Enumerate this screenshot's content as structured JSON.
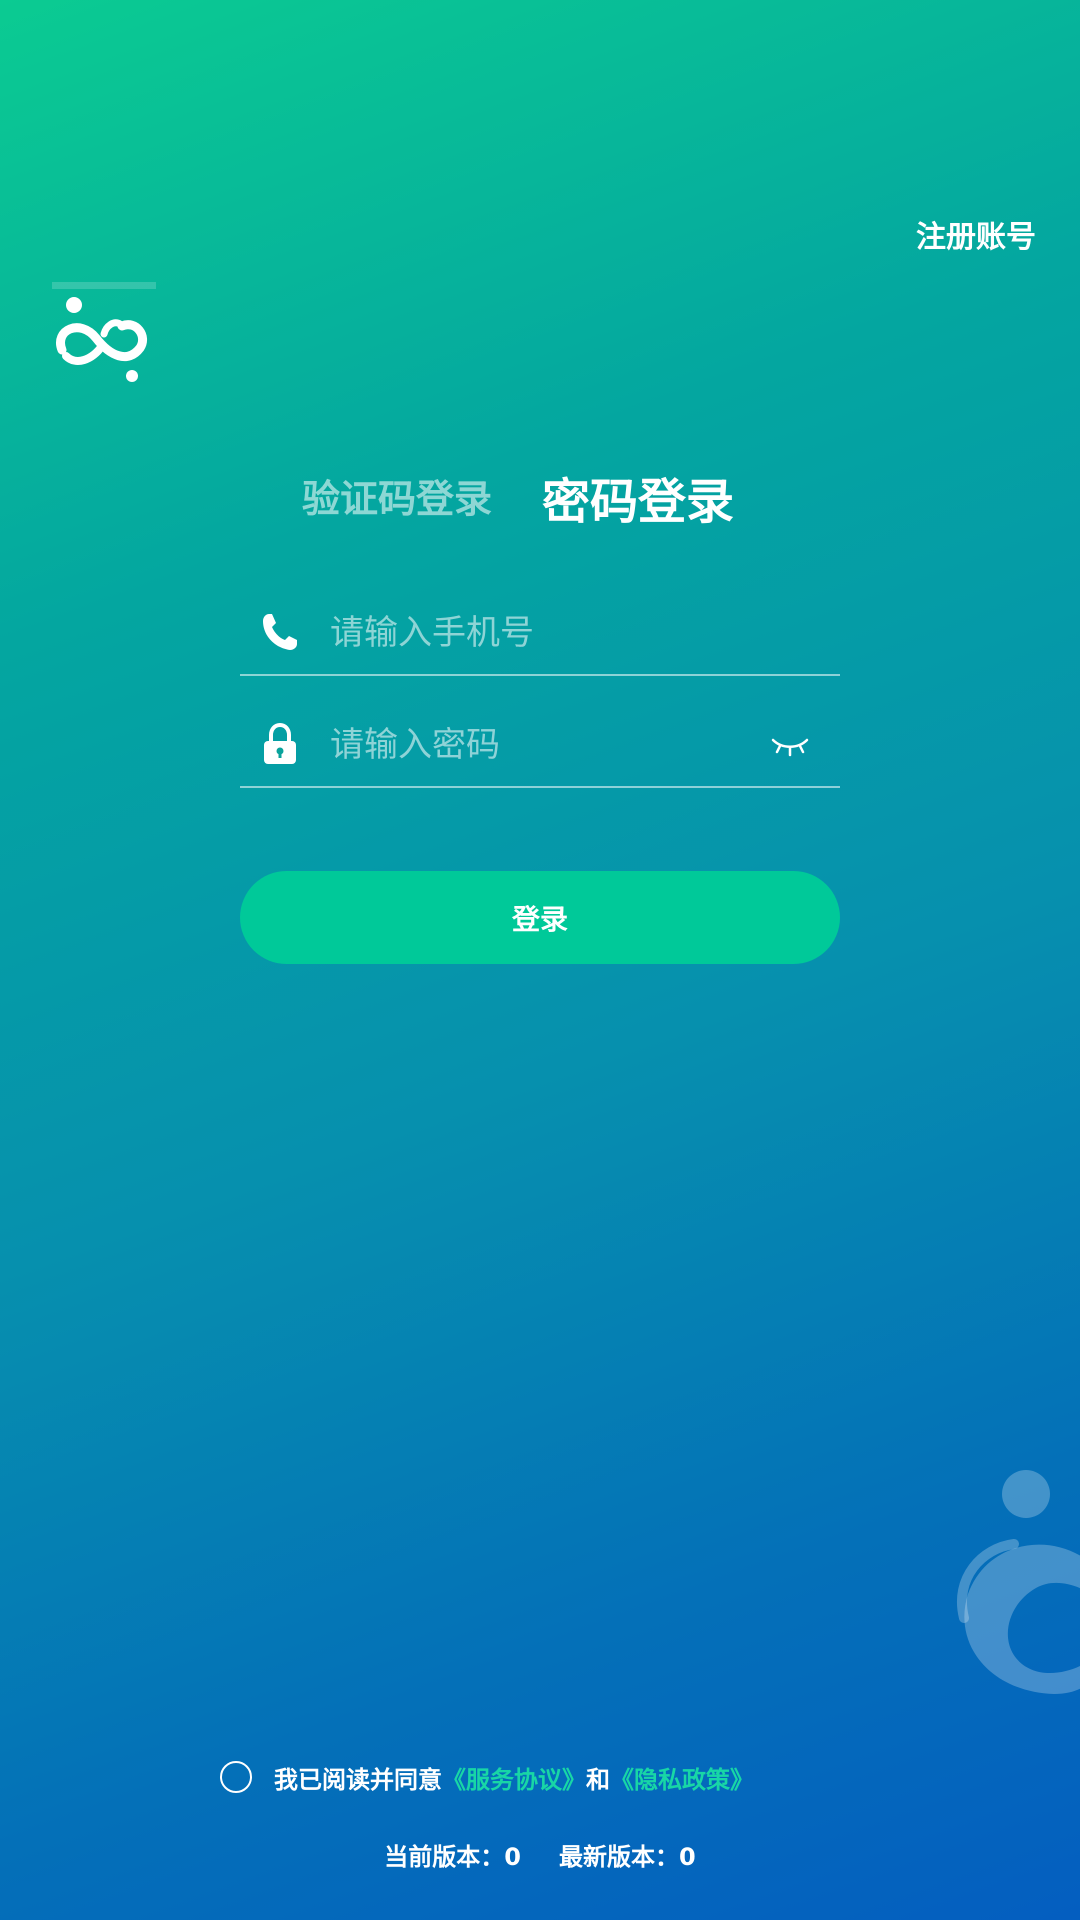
{
  "header": {
    "register_label": "注册账号"
  },
  "tabs": [
    {
      "label": "验证码登录",
      "active": false
    },
    {
      "label": "密码登录",
      "active": true
    }
  ],
  "form": {
    "phone": {
      "placeholder": "请输入手机号",
      "value": "",
      "icon": "phone-icon"
    },
    "password": {
      "placeholder": "请输入密码",
      "value": "",
      "icon": "lock-icon",
      "toggle_icon": "eye-closed-icon"
    },
    "login_label": "登录"
  },
  "agreement": {
    "checked": false,
    "prefix": "我已阅读并同意",
    "service_link": "《服务协议》",
    "and": "和",
    "privacy_link": "《隐私政策》"
  },
  "version": {
    "current_label": "当前版本：",
    "current_value": "0",
    "latest_label": "最新版本：",
    "latest_value": "0"
  },
  "colors": {
    "accent": "#00c999",
    "link": "#18d6a6",
    "gradient_start": "#0bcb92",
    "gradient_end": "#045ec0"
  }
}
